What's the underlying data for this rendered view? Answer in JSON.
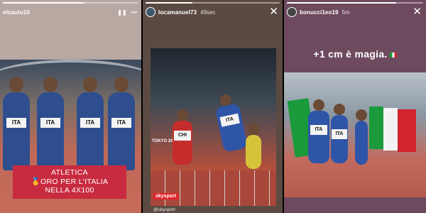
{
  "stories": [
    {
      "username": "elcauto10",
      "time": "",
      "progress": 0.6,
      "controls": {
        "pause": "❚❚",
        "more": "•••"
      },
      "photo": {
        "bibs": [
          "ITA",
          "ITA",
          "ITA",
          "ITA"
        ]
      },
      "banner": {
        "line1": "ATLETICA",
        "line2": "🥇ORO PER L'ITALIA",
        "line3": "NELLA 4X100"
      },
      "colors": {
        "banner_bg": "#c82b3f",
        "story_bg": "#b8a8a2"
      }
    },
    {
      "username": "locamanuel73",
      "time": "49sec",
      "progress": 0.35,
      "photo": {
        "bibs": [
          "CHI",
          "ITA"
        ],
        "olympic_text": "TOKYO 2020",
        "logo": "skysport"
      },
      "credit": "@skysport",
      "close_glyph": "✕",
      "colors": {
        "story_bg": "#5b4a42"
      }
    },
    {
      "username": "bonucci1eo19",
      "time": "5m",
      "progress": 0.8,
      "quote": "+1 cm è magia.",
      "photo": {
        "bibs": [
          "ITA",
          "ITA"
        ]
      },
      "close_glyph": "✕",
      "colors": {
        "story_bg": "#6e4a5e",
        "flag_green": "#1a9a3b",
        "flag_red": "#d1242f"
      }
    }
  ]
}
